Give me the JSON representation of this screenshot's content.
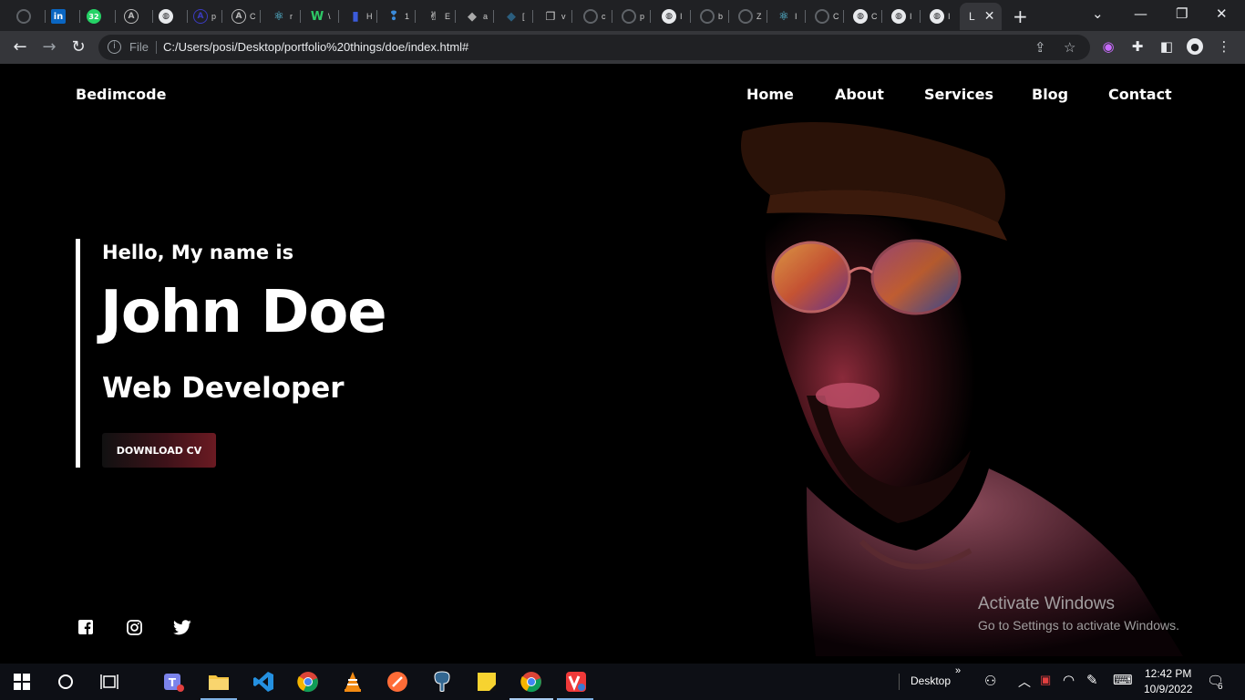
{
  "browser": {
    "tabs": [
      {
        "icon": "github-icon",
        "char": ""
      },
      {
        "icon": "linkedin-icon",
        "char": ""
      },
      {
        "icon": "whatsapp-icon",
        "char": ""
      },
      {
        "icon": "ace-icon",
        "char": ""
      },
      {
        "icon": "globe-icon",
        "char": ""
      },
      {
        "icon": "ace-icon",
        "char": "p"
      },
      {
        "icon": "ace-icon",
        "char": "C"
      },
      {
        "icon": "react-icon",
        "char": "r"
      },
      {
        "icon": "w-icon",
        "char": "\\"
      },
      {
        "icon": "bookmark-icon",
        "char": "H"
      },
      {
        "icon": "bookmark-icon",
        "char": "1"
      },
      {
        "icon": "hand-icon",
        "char": "E"
      },
      {
        "icon": "diamond-icon",
        "char": "a"
      },
      {
        "icon": "diamond-icon",
        "char": "["
      },
      {
        "icon": "files-icon",
        "char": "v"
      },
      {
        "icon": "github-icon",
        "char": "c"
      },
      {
        "icon": "github-icon",
        "char": "p"
      },
      {
        "icon": "globe-icon",
        "char": "I"
      },
      {
        "icon": "github-icon",
        "char": "b"
      },
      {
        "icon": "github-icon",
        "char": "Z"
      },
      {
        "icon": "react-icon",
        "char": "I"
      },
      {
        "icon": "github-icon",
        "char": "C"
      },
      {
        "icon": "globe-icon",
        "char": "C"
      },
      {
        "icon": "globe-icon",
        "char": "I"
      },
      {
        "icon": "globe-icon",
        "char": "I"
      }
    ],
    "active_tab_char": "L",
    "whatsapp_badge": "32",
    "linkedin_text": "in",
    "address": {
      "scheme_label": "File",
      "url": "C:/Users/posi/Desktop/portfolio%20things/doe/index.html#"
    }
  },
  "page": {
    "logo": "Bedimcode",
    "nav": [
      "Home",
      "About",
      "Services",
      "Blog",
      "Contact"
    ],
    "hero": {
      "greeting": "Hello, My name is",
      "name": "John Doe",
      "role": "Web Developer",
      "cta": "DOWNLOAD CV"
    },
    "social": [
      "facebook-icon",
      "instagram-icon",
      "twitter-icon"
    ],
    "watermark": {
      "title": "Activate Windows",
      "subtitle": "Go to Settings to activate Windows."
    }
  },
  "taskbar": {
    "apps": [
      "start-icon",
      "search-circle-icon",
      "task-view-icon",
      "teams-icon",
      "file-explorer-icon",
      "vscode-icon",
      "chrome-icon",
      "vlc-icon",
      "postman-icon",
      "postgres-icon",
      "sticky-notes-icon",
      "chrome-icon",
      "vivaldi-icon"
    ],
    "desktop_label": "Desktop",
    "time": "12:42 PM",
    "date": "10/9/2022",
    "notification_count": "6"
  },
  "colors": {
    "accent_red": "#6b1a22",
    "text_white": "#ffffff",
    "browser_dark": "#202124"
  }
}
